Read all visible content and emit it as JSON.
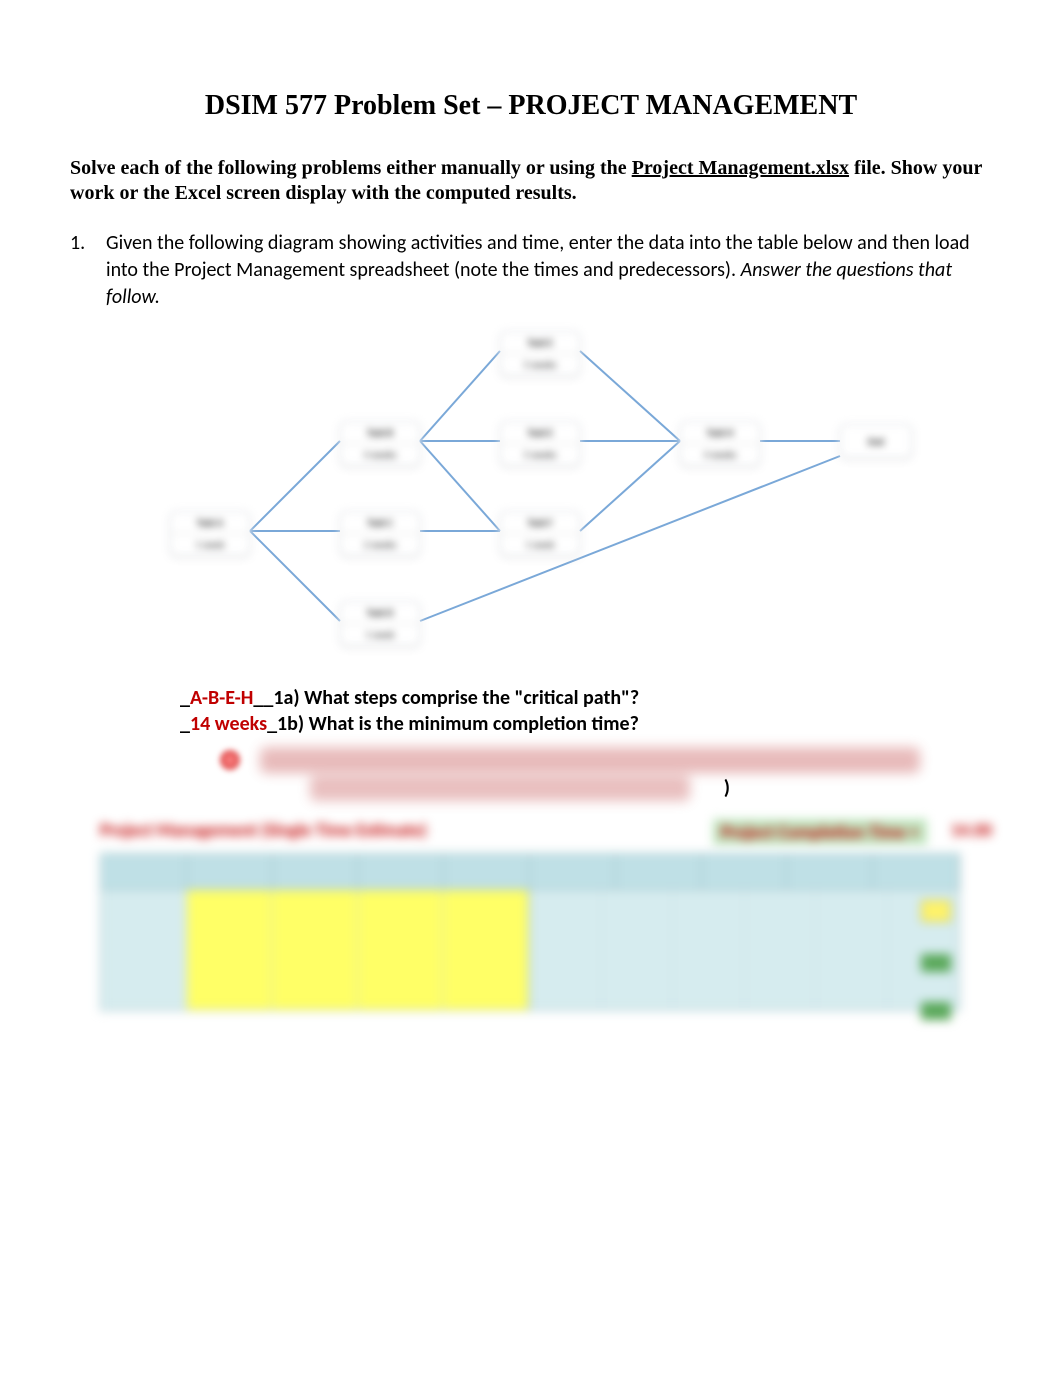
{
  "title": "DSIM 577 Problem Set – PROJECT MANAGEMENT",
  "intro_pre": "Solve each of the following problems either manually or using the ",
  "intro_link": "Project Management.xlsx",
  "intro_post": " file.  Show your work or the Excel screen display with the computed results.",
  "q1": {
    "num": "1.",
    "text_a": "Given the following diagram showing activities and time, enter the data into the table below and then load into the Project Management spreadsheet (note the times and predecessors).  ",
    "text_b": "Answer the questions that follow."
  },
  "diagram": {
    "nodes": {
      "A": {
        "label": "Task A",
        "dur": "1 week"
      },
      "B": {
        "label": "Task B",
        "dur": "4 weeks"
      },
      "C": {
        "label": "Task C",
        "dur": "2 weeks"
      },
      "D": {
        "label": "Task D",
        "dur": "1 week"
      },
      "E": {
        "label": "Task E",
        "dur": "5 weeks"
      },
      "F": {
        "label": "Task F",
        "dur": "1 week"
      },
      "G": {
        "label": "Task G",
        "dur": "3 weeks"
      },
      "H": {
        "label": "Task H",
        "dur": "4 weeks"
      },
      "END": {
        "label": "End"
      }
    }
  },
  "answers": {
    "a_prefix": "_",
    "a_value": "A-B-E-H",
    "a_suffix": "__1a)",
    "a_q": "  What steps comprise the \"critical path\"?",
    "b_prefix": "_",
    "b_value": "14 weeks",
    "b_suffix": "_1b)",
    "b_q": "  What is the minimum completion time?",
    "paren": ")"
  },
  "sheet": {
    "left_title": "Project Management (Single Time Estimate)",
    "right_title": "Project Completion Time =",
    "right_value": "14.00"
  }
}
